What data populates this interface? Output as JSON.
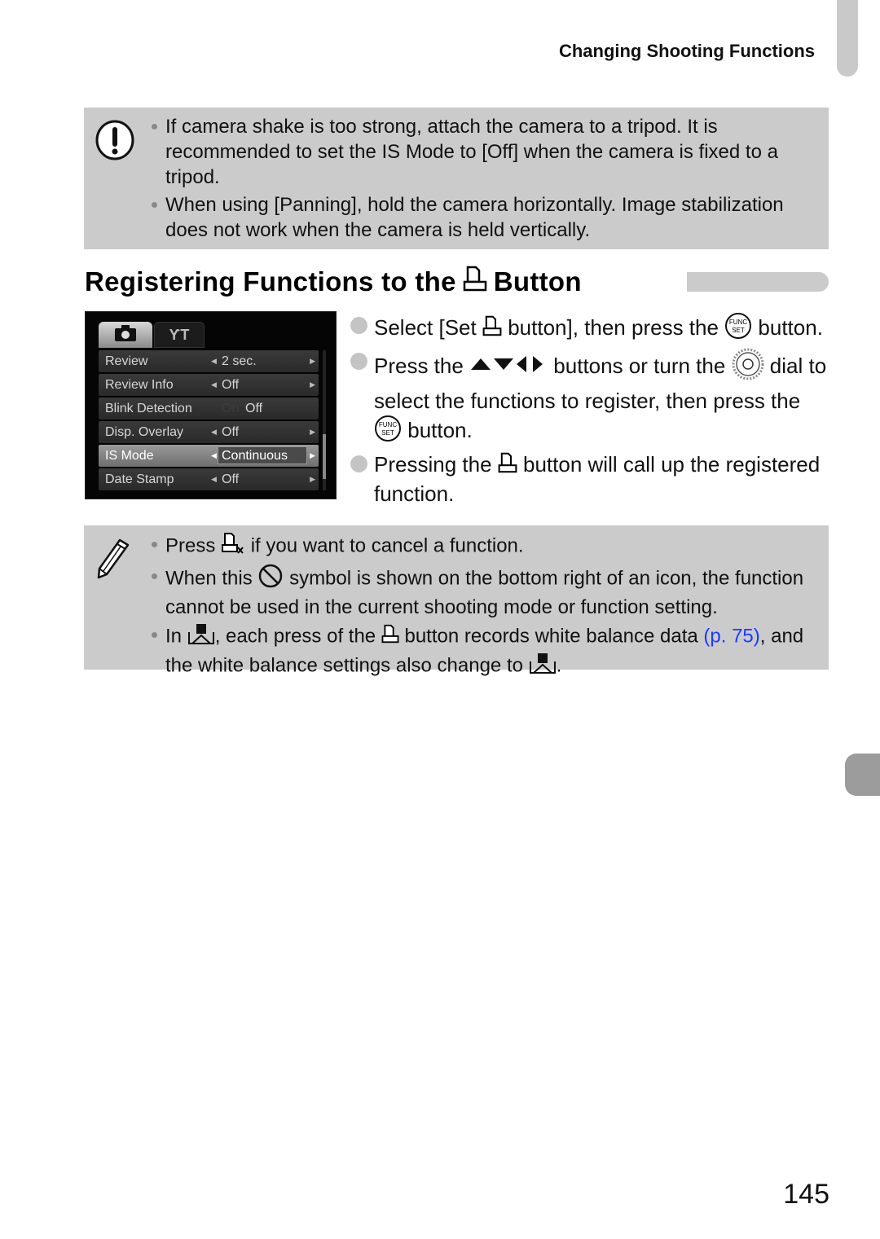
{
  "header": {
    "section_title": "Changing Shooting Functions"
  },
  "caution_box": {
    "icon": "caution-exclamation-icon",
    "bullets": [
      "If camera shake is too strong, attach the camera to a tripod. It is recommended to set the IS Mode to [Off] when the camera is fixed to a tripod.",
      "When using [Panning], hold the camera horizontally. Image stabilization does not work when the camera is held vertically."
    ]
  },
  "section": {
    "title_before": "Registering Functions to the",
    "title_icon": "shortcut-button-icon",
    "title_after": "Button"
  },
  "camera_screen": {
    "tabs": [
      {
        "icon": "camera-tab-icon",
        "selected": true
      },
      {
        "icon": "tools-tab-icon",
        "label": "ƳT",
        "selected": false
      }
    ],
    "menu": [
      {
        "label": "Review",
        "value": "2 sec."
      },
      {
        "label": "Review Info",
        "value": "Off"
      },
      {
        "label": "Blink Detection",
        "dim_option": "On",
        "value": "Off"
      },
      {
        "label": "Disp. Overlay",
        "value": "Off"
      },
      {
        "label": "IS Mode",
        "value": "Continuous",
        "selected": true
      },
      {
        "label": "Date Stamp",
        "value": "Off"
      }
    ]
  },
  "steps": {
    "step1": {
      "a": "Select [Set",
      "b": "button], then press the",
      "c": "button."
    },
    "step2": {
      "a": "Press the",
      "b": "buttons or turn the",
      "c": "dial to select the functions to register, then press the",
      "d": "button."
    },
    "step3": {
      "a": "Pressing the",
      "b": "button will call up the registered function."
    }
  },
  "note_box": {
    "icon": "pencil-note-icon",
    "bullet1": {
      "a": "Press",
      "b": "if you want to cancel a function."
    },
    "bullet2": {
      "a": "When this",
      "b": "symbol is shown on the bottom right of an icon, the function cannot be used in the current shooting mode or function setting."
    },
    "bullet3": {
      "a": "In",
      "b": ", each press of the",
      "c": "button records white balance data",
      "link": "(p. 75)",
      "d": ", and the white balance settings also change to",
      "e": "."
    },
    "link_color": "#1a3cff"
  },
  "page_number": "145"
}
